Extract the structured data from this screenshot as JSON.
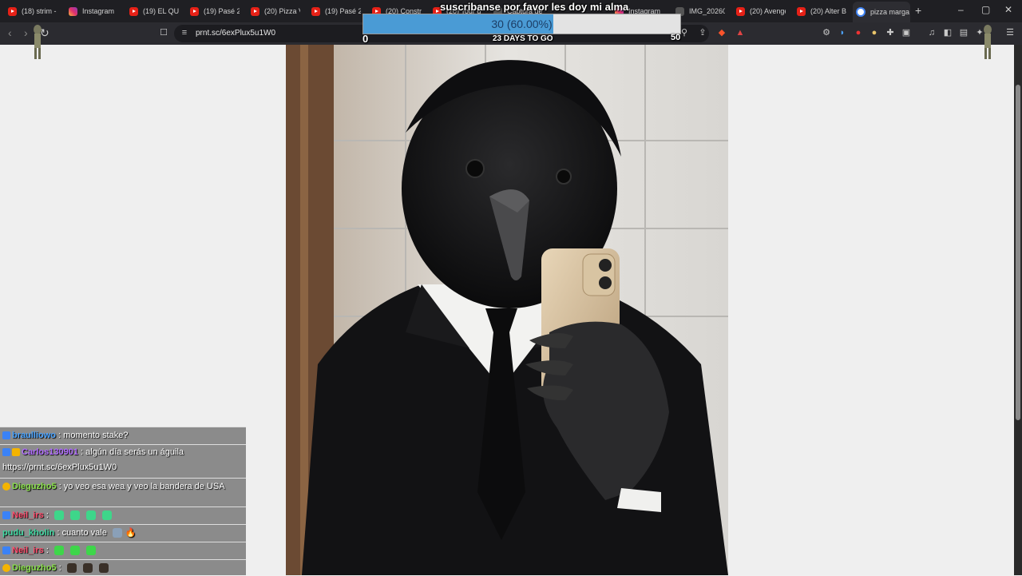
{
  "tabs": [
    {
      "label": "(18) strim -",
      "icon": "youtube-icon"
    },
    {
      "label": "Instagram",
      "icon": "instagram-icon"
    },
    {
      "label": "(19) EL QUI",
      "icon": "youtube-icon"
    },
    {
      "label": "(19) Pasé 24",
      "icon": "youtube-icon"
    },
    {
      "label": "(20) Pizza Vi",
      "icon": "youtube-icon"
    },
    {
      "label": "(19) Pasé 24",
      "icon": "youtube-icon"
    },
    {
      "label": "(20) Constru",
      "icon": "youtube-icon"
    },
    {
      "label": "(20) Tour d",
      "icon": "youtube-icon"
    },
    {
      "label": "Captura de",
      "icon": "image-icon"
    },
    {
      "label": "Instagram",
      "icon": "instagram-icon"
    },
    {
      "label": "IMG_20260",
      "icon": "image-icon"
    },
    {
      "label": "(20) Avenge",
      "icon": "youtube-icon"
    },
    {
      "label": "(20) Alter B",
      "icon": "youtube-icon"
    },
    {
      "label": "pizza marga",
      "icon": "google-icon"
    }
  ],
  "address_bar": {
    "url": "prnt.sc/6exPlux5u1W0"
  },
  "stream_overlay": {
    "subscribe_text": "suscribanse por favor les doy mi alma",
    "goal": {
      "current_text": "30 (60.00%)",
      "progress_fraction": 0.6,
      "min_label": "0",
      "max_label": "50",
      "days_text": "23 DAYS TO GO",
      "fill_color": "#4a9bd5"
    }
  },
  "chat": [
    {
      "user": "braulliowo",
      "user_color": "#4aa3ff",
      "text": ": momento stake?",
      "badges": [
        "badge-icon"
      ]
    },
    {
      "user": "Carlos130901",
      "user_color": "#b06cff",
      "text": ": algún día serás un águila",
      "badges": [
        "badge-icon",
        "sub-badge-icon"
      ]
    },
    {
      "user": "",
      "user_color": "#ffffff",
      "text": "https://prnt.sc/6exPlux5u1W0",
      "badges": []
    },
    {
      "user": "Dieguzho5",
      "user_color": "#8ae04b",
      "text": ": yo veo esa wea y veo la bandera de USA",
      "badges": [
        "coin-badge-icon"
      ]
    },
    {
      "user": "Neil_irs",
      "user_color": "#ff4d6d",
      "text": ":",
      "badges": [
        "badge-icon"
      ],
      "emotes": 4
    },
    {
      "user": "pudu_kholin",
      "user_color": "#3ed6a0",
      "text": ": cuanto vale",
      "badges": [],
      "emotes": 1,
      "extra": "🔥"
    },
    {
      "user": "Neil_irs",
      "user_color": "#ff4d6d",
      "text": ":",
      "badges": [
        "badge-icon"
      ],
      "emotes": 3
    },
    {
      "user": "Dieguzho5",
      "user_color": "#8ae04b",
      "text": ":",
      "badges": [
        "coin-badge-icon"
      ],
      "emotes": 3
    }
  ]
}
